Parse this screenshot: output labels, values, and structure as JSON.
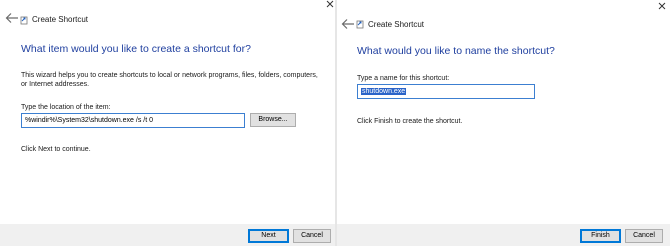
{
  "left": {
    "window_title": "Create Shortcut",
    "heading": "What item would you like to create a shortcut for?",
    "description": "This wizard helps you to create shortcuts to local or network programs, files, folders, computers, or Internet addresses.",
    "location_label": "Type the location of the item:",
    "location_value": "%windir%\\System32\\shutdown.exe /s /t 0",
    "browse_label": "Browse...",
    "instruction": "Click Next to continue.",
    "next_label": "Next",
    "cancel_label": "Cancel"
  },
  "right": {
    "window_title": "Create Shortcut",
    "heading": "What would you like to name the shortcut?",
    "name_label": "Type a name for this shortcut:",
    "name_value": "shutdown.exe",
    "instruction": "Click Finish to create the shortcut.",
    "finish_label": "Finish",
    "cancel_label": "Cancel"
  },
  "colors": {
    "heading": "#1f3f9f",
    "focus_border": "#3c7fd1",
    "selection": "#2b64c8"
  },
  "icons": {
    "back": "back-arrow-icon",
    "close": "close-icon",
    "wizard": "shortcut-wizard-icon"
  }
}
